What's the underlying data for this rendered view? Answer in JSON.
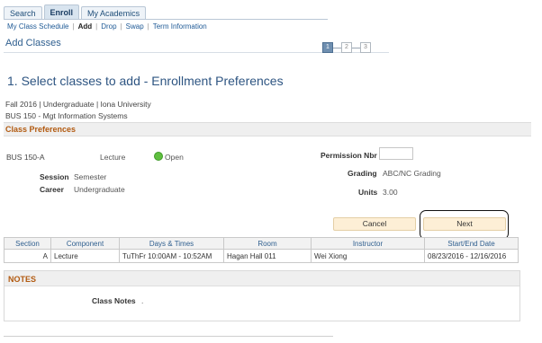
{
  "tabs": [
    {
      "label": "Search"
    },
    {
      "label": "Enroll"
    },
    {
      "label": "My Academics"
    }
  ],
  "subnav": [
    {
      "label": "My Class Schedule"
    },
    {
      "label": "Add"
    },
    {
      "label": "Drop"
    },
    {
      "label": "Swap"
    },
    {
      "label": "Term Information"
    }
  ],
  "page_title": "Add Classes",
  "steps": [
    "1",
    "2",
    "3"
  ],
  "heading": "1.  Select classes to add - Enrollment Preferences",
  "term_line": "Fall 2016 | Undergraduate | Iona University",
  "course_line": "BUS  150 - Mgt Information Systems",
  "preferences": {
    "title": "Class Preferences",
    "section": "BUS  150-A",
    "component": "Lecture",
    "status": "Open",
    "session_label": "Session",
    "session_value": "Semester",
    "career_label": "Career",
    "career_value": "Undergraduate",
    "permission_label": "Permission Nbr",
    "permission_value": "",
    "grading_label": "Grading",
    "grading_value": "ABC/NC Grading",
    "units_label": "Units",
    "units_value": "3.00"
  },
  "buttons": {
    "cancel": "Cancel",
    "next": "Next"
  },
  "table": {
    "headers": [
      "Section",
      "Component",
      "Days & Times",
      "Room",
      "Instructor",
      "Start/End Date"
    ],
    "rows": [
      [
        "A",
        "Lecture",
        "TuThFr 10:00AM - 10:52AM",
        "Hagan Hall  011",
        "Wei Xiong",
        "08/23/2016 - 12/16/2016"
      ]
    ]
  },
  "notes": {
    "title": "NOTES",
    "label": "Class Notes",
    "value": "."
  },
  "colors": {
    "accent": "#2e5582",
    "section_title": "#b25a10",
    "status_open": "#5fbf3f",
    "button_bg": "#fdefd6"
  }
}
